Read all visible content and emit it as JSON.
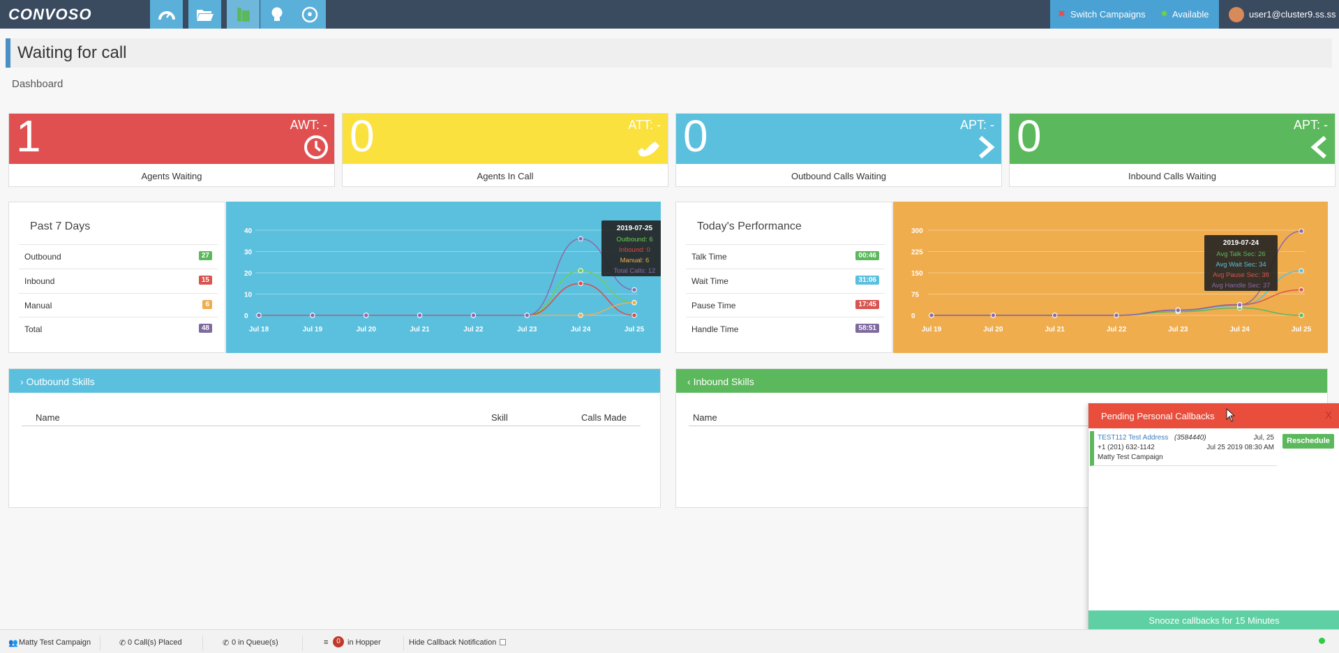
{
  "topbar": {
    "logo": "CONVOSO",
    "nav_icons": [
      "dashboard-icon",
      "folder-icon",
      "phone-icon",
      "lightbulb-icon",
      "soccer-ball-icon"
    ],
    "switch_campaigns": "Switch Campaigns",
    "status": "Available",
    "user": "user1@cluster9.ss.ss"
  },
  "page": {
    "title": "Waiting for call",
    "subtitle": "Dashboard"
  },
  "stats": [
    {
      "value": "1",
      "abbr": "AWT: -",
      "label": "Agents Waiting",
      "color": "#e05050",
      "icon": "clock-icon"
    },
    {
      "value": "0",
      "abbr": "ATT: -",
      "label": "Agents In Call",
      "color": "#fbe13e",
      "icon": "phone-icon"
    },
    {
      "value": "0",
      "abbr": "APT: -",
      "label": "Outbound Calls Waiting",
      "color": "#5bc0de",
      "icon": "chevron-right-icon"
    },
    {
      "value": "0",
      "abbr": "APT: -",
      "label": "Inbound Calls Waiting",
      "color": "#5cb85c",
      "icon": "chevron-left-icon"
    }
  ],
  "past7": {
    "title": "Past 7 Days",
    "rows": [
      {
        "label": "Outbound",
        "value": "27",
        "color": "#5cb85c"
      },
      {
        "label": "Inbound",
        "value": "15",
        "color": "#d9534f"
      },
      {
        "label": "Manual",
        "value": "6",
        "color": "#f0ad4e"
      },
      {
        "label": "Total",
        "value": "48",
        "color": "#7e6a9e"
      }
    ]
  },
  "performance": {
    "title": "Today's Performance",
    "rows": [
      {
        "label": "Talk Time",
        "value": "00:46",
        "color": "#5cb85c"
      },
      {
        "label": "Wait Time",
        "value": "31:06",
        "color": "#5bc0de"
      },
      {
        "label": "Pause Time",
        "value": "17:45",
        "color": "#d9534f"
      },
      {
        "label": "Handle Time",
        "value": "58:51",
        "color": "#7e6a9e"
      }
    ]
  },
  "chart_data": [
    {
      "type": "line",
      "x": [
        "Jul 18",
        "Jul 19",
        "Jul 20",
        "Jul 21",
        "Jul 22",
        "Jul 23",
        "Jul 24",
        "Jul 25"
      ],
      "ylim": [
        0,
        40
      ],
      "yticks": [
        0,
        10,
        20,
        30,
        40
      ],
      "background": "#5bc0de",
      "series": [
        {
          "name": "Outbound",
          "color": "#6dd04a",
          "values": [
            0,
            0,
            0,
            0,
            0,
            0,
            21,
            6
          ]
        },
        {
          "name": "Inbound",
          "color": "#e0473e",
          "values": [
            0,
            0,
            0,
            0,
            0,
            0,
            15,
            0
          ]
        },
        {
          "name": "Manual",
          "color": "#f0ad4e",
          "values": [
            0,
            0,
            0,
            0,
            0,
            0,
            0,
            6
          ]
        },
        {
          "name": "Total Calls",
          "color": "#8a6aa8",
          "values": [
            0,
            0,
            0,
            0,
            0,
            0,
            36,
            12
          ]
        }
      ],
      "tooltip": {
        "title": "2019-07-25",
        "lines": [
          "Outbound: 6",
          "Inbound: 0",
          "Manual: 6",
          "Total Calls: 12"
        ]
      }
    },
    {
      "type": "line",
      "x": [
        "Jul 19",
        "Jul 20",
        "Jul 21",
        "Jul 22",
        "Jul 23",
        "Jul 24",
        "Jul 25"
      ],
      "ylim": [
        0,
        300
      ],
      "yticks": [
        0,
        75,
        150,
        225,
        300
      ],
      "background": "#f0ad4e",
      "series": [
        {
          "name": "Avg Talk Sec",
          "color": "#5cb85c",
          "values": [
            0,
            0,
            0,
            0,
            13,
            26,
            0
          ]
        },
        {
          "name": "Avg Wait Sec",
          "color": "#5bc0de",
          "values": [
            0,
            0,
            0,
            0,
            17,
            34,
            157
          ]
        },
        {
          "name": "Avg Pause Sec",
          "color": "#d9534f",
          "values": [
            0,
            0,
            0,
            0,
            19,
            38,
            90
          ]
        },
        {
          "name": "Avg Handle Sec",
          "color": "#8a6aa8",
          "values": [
            0,
            0,
            0,
            0,
            18,
            37,
            297
          ]
        }
      ],
      "tooltip": {
        "title": "2019-07-24",
        "lines": [
          "Avg Talk Sec: 26",
          "Avg Wait Sec: 34",
          "Avg Pause Sec: 38",
          "Avg Handle Sec: 37"
        ]
      }
    }
  ],
  "outbound_skills": {
    "title": "Outbound Skills",
    "cols": [
      "Name",
      "Skill",
      "Calls Made"
    ]
  },
  "inbound_skills": {
    "title": "Inbound Skills",
    "cols": [
      "Name"
    ]
  },
  "callbacks": {
    "title": "Pending Personal Callbacks",
    "close": "X",
    "item": {
      "name": "TEST112 Test Address",
      "id": "(3584440)",
      "phone": "+1 (201) 632-1142",
      "campaign": "Matty Test Campaign",
      "date_short": "Jul, 25",
      "date_full": "Jul 25 2019 08:30 AM",
      "action": "Reschedule"
    },
    "snooze": "Snooze callbacks for 15 Minutes"
  },
  "statusbar": {
    "campaign": "Matty Test Campaign",
    "placed": "0 Call(s) Placed",
    "queue": "0 in Queue(s)",
    "hopper_count": "0",
    "hopper": "in Hopper",
    "hide_notification": "Hide Callback Notification"
  }
}
